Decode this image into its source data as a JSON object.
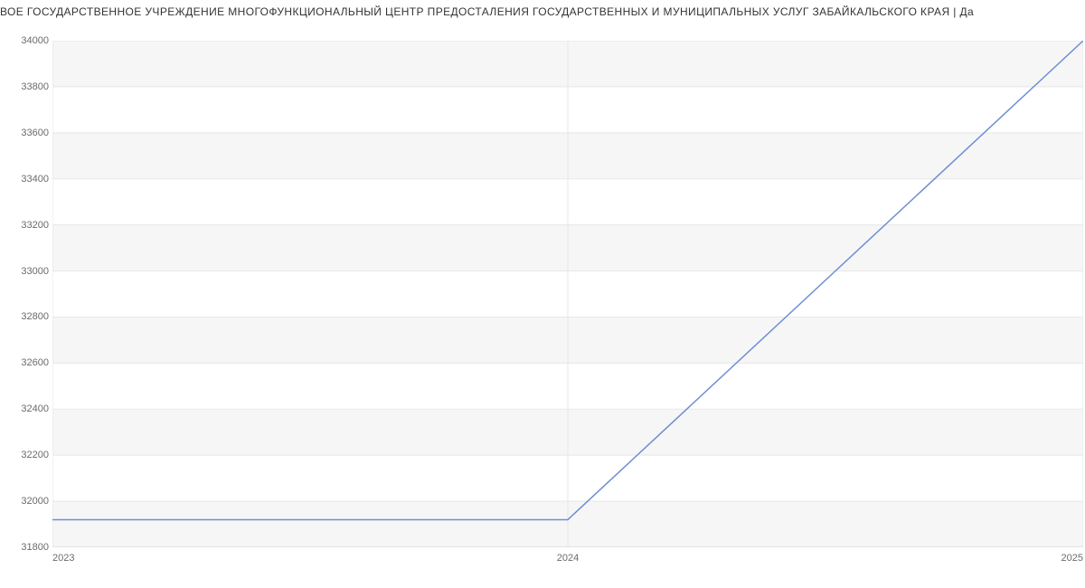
{
  "chart_data": {
    "type": "line",
    "title": "ВОЕ ГОСУДАРСТВЕННОЕ УЧРЕЖДЕНИЕ МНОГОФУНКЦИОНАЛЬНЫЙ ЦЕНТР ПРЕДОСТАЛЕНИЯ ГОСУДАРСТВЕННЫХ И МУНИЦИПАЛЬНЫХ УСЛУГ ЗАБАЙКАЛЬСКОГО КРАЯ | Да",
    "xlabel": "",
    "ylabel": "",
    "x": [
      2023,
      2024,
      2025
    ],
    "y": [
      31920,
      31920,
      34000
    ],
    "x_ticks": [
      2023,
      2024,
      2025
    ],
    "y_ticks": [
      31800,
      32000,
      32200,
      32400,
      32600,
      32800,
      33000,
      33200,
      33400,
      33600,
      33800,
      34000
    ],
    "ylim": [
      31800,
      34000
    ],
    "xlim": [
      2023,
      2025
    ],
    "colors": {
      "line": "#6e8fd3",
      "band": "#f6f6f6",
      "grid": "#e7e7e7"
    }
  }
}
